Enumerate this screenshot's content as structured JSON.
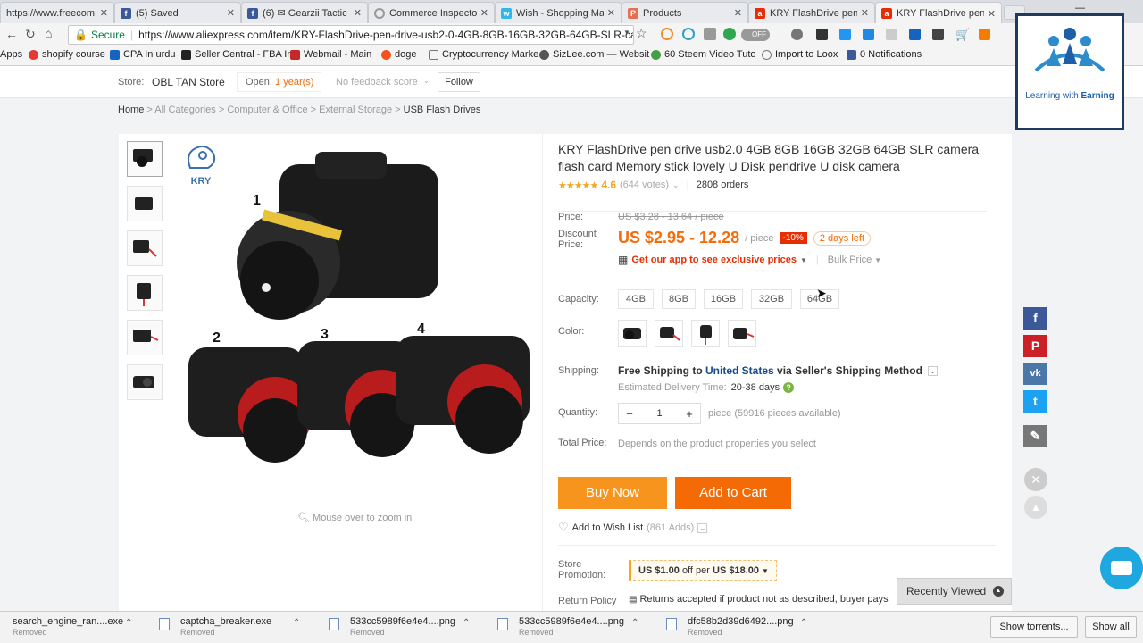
{
  "tabs": [
    {
      "title": "https://www.freecom",
      "icon": "page-icon"
    },
    {
      "title": "(5) Saved",
      "icon": "facebook-icon"
    },
    {
      "title": "(6) ✉ Gearzii Tactic",
      "icon": "facebook-icon"
    },
    {
      "title": "Commerce Inspector",
      "icon": "loading-icon"
    },
    {
      "title": "Wish - Shopping Ma",
      "icon": "wish-icon"
    },
    {
      "title": "Products",
      "icon": "products-icon"
    },
    {
      "title": "KRY FlashDrive pen",
      "icon": "aliexpress-icon"
    },
    {
      "title": "KRY FlashDrive pen d",
      "icon": "aliexpress-icon"
    }
  ],
  "address": {
    "secure_label": "Secure",
    "url": "https://www.aliexpress.com/item/KRY-FlashDrive-pen-drive-usb2-0-4GB-8GB-16GB-32GB-64GB-SLR-came",
    "toggle_label": "OFF"
  },
  "bookmarks": [
    "Apps",
    "shopify course",
    "CPA In urdu",
    "Seller Central - FBA In",
    "Webmail - Main",
    "doge",
    "Cryptocurrency Marke",
    "SizLee.com — Websit",
    "60 Steem Video Tuto",
    "Import to Loox",
    "0 Notifications"
  ],
  "overlay_logo": {
    "text_main": "Learning with ",
    "text_bold": "Earning"
  },
  "store": {
    "label": "Store:",
    "name": "OBL TAN Store",
    "open_label": "Open:",
    "open_value": "1 year(s)",
    "feedback": "No feedback score",
    "follow": "Follow"
  },
  "breadcrumb": [
    "Home",
    "All Categories",
    "Computer & Office",
    "External Storage",
    "USB Flash Drives"
  ],
  "gallery": {
    "brand": "KRY",
    "numbers": [
      "1",
      "2",
      "3",
      "4"
    ],
    "zoom_hint": "Mouse over to zoom in"
  },
  "product": {
    "title": "KRY FlashDrive pen drive usb2.0 4GB 8GB 16GB 32GB 64GB SLR camera flash card Memory stick lovely U Disk pendrive U disk camera",
    "rating": "4.6",
    "rating_stars": 4.6,
    "votes": "(644 votes)",
    "orders": "2808 orders",
    "price_label": "Price:",
    "original_price": "US $3.28 - 13.64 / piece",
    "discount_label": "Discount Price:",
    "discount_price": "US $2.95 - 12.28",
    "per_piece": "/ piece",
    "discount_badge": "-10%",
    "days_left": "2 days left",
    "app_promo": "Get our app to see exclusive prices",
    "bulk_price": "Bulk Price",
    "capacity_label": "Capacity:",
    "capacities": [
      "4GB",
      "8GB",
      "16GB",
      "32GB",
      "64GB"
    ],
    "color_label": "Color:",
    "shipping_label": "Shipping:",
    "shipping_text": "Free Shipping to",
    "shipping_country": "United States",
    "shipping_via": "via Seller's Shipping Method",
    "delivery_label": "Estimated Delivery Time:",
    "delivery_value": "20-38 days",
    "quantity_label": "Quantity:",
    "quantity_value": "1",
    "pieces_available": "piece (59916 pieces available)",
    "total_label": "Total Price:",
    "total_value": "Depends on the product properties you select",
    "buy_now": "Buy Now",
    "add_to_cart": "Add to Cart",
    "wishlist": "Add to Wish List",
    "wishlist_count": "(861 Adds)",
    "promo_label": "Store Promotion:",
    "promo_amount": "US $1.00",
    "promo_mid": "off per",
    "promo_threshold": "US $18.00",
    "return_label": "Return Policy",
    "return_text": "Returns accepted if product not as described, buyer pays"
  },
  "recently_viewed": "Recently Viewed",
  "social": [
    "f",
    "P",
    "vk",
    "t",
    "✎"
  ],
  "downloads": [
    {
      "name": "search_engine_ran....exe",
      "status": "Removed"
    },
    {
      "name": "captcha_breaker.exe",
      "status": "Removed"
    },
    {
      "name": "533cc5989f6e4e4....png",
      "status": "Removed"
    },
    {
      "name": "533cc5989f6e4e4....png",
      "status": "Removed"
    },
    {
      "name": "dfc58b2d39d6492....png",
      "status": "Removed"
    }
  ],
  "download_buttons": {
    "torrents": "Show torrents...",
    "show_all": "Show all"
  },
  "colors": {
    "accent_orange": "#f56c08",
    "buy_now": "#f7941d",
    "add_to_cart": "#f46b05",
    "facebook": "#3b5998",
    "pinterest": "#cb2027",
    "vk": "#4a76a8",
    "twitter": "#1da1f2"
  }
}
